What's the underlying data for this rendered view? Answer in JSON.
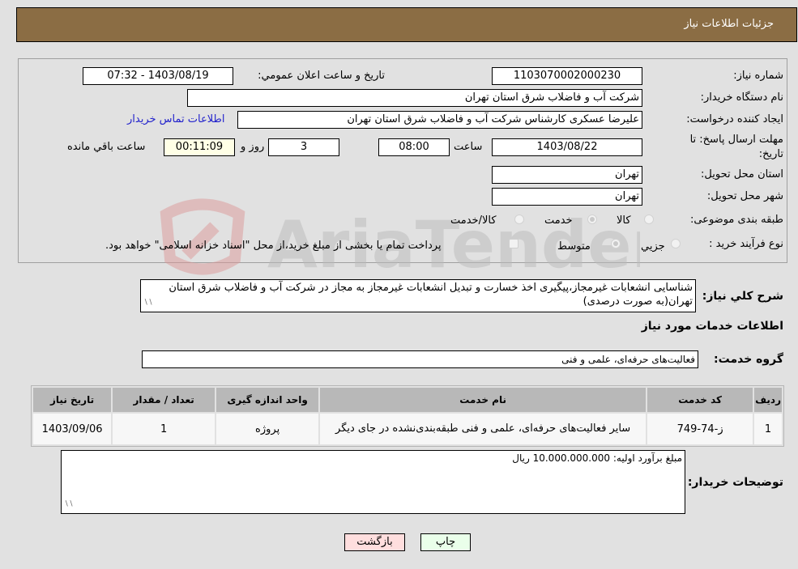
{
  "header": {
    "title": "جزئیات اطلاعات نیاز"
  },
  "details": {
    "need_number_label": "شماره نیاز:",
    "need_number": "1103070002000230",
    "announce_label": "تاریخ و ساعت اعلان عمومي:",
    "announce_value": "1403/08/19 - 07:32",
    "buyer_org_label": "نام دستگاه خریدار:",
    "buyer_org": "شرکت آب و فاضلاب شرق استان تهران",
    "creator_label": "ایجاد کننده درخواست:",
    "creator": "علیرضا عسکری کارشناس شرکت آب و فاضلاب شرق استان تهران",
    "contact_link": "اطلاعات تماس خریدار",
    "deadline_label": "مهلت ارسال پاسخ: تا تاریخ:",
    "deadline_date": "1403/08/22",
    "time_label": "ساعت",
    "deadline_time": "08:00",
    "days_value": "3",
    "days_label": "روز و",
    "remaining_value": "00:11:09",
    "remaining_label": "ساعت باقي مانده",
    "province_label": "استان محل تحویل:",
    "province": "تهران",
    "city_label": "شهر محل تحویل:",
    "city": "تهران",
    "category_label": "طبقه بندی موضوعی:",
    "category_options": [
      "کالا",
      "خدمت",
      "کالا/خدمت"
    ],
    "category_selected": "خدمت",
    "process_label": "نوع فرآیند خرید :",
    "process_options": [
      "جزيي",
      "متوسط"
    ],
    "process_selected": "متوسط",
    "treasury_note": "پرداخت تمام یا بخشی از مبلغ خرید،از محل \"اسناد خزانه اسلامی\" خواهد بود.",
    "treasury_checked": false
  },
  "description": {
    "label": "شرح کلي نياز:",
    "text": "شناسایی انشعابات غیرمجاز،پیگیری اخذ خسارت و تبدیل انشعابات غیرمجاز به مجاز در شرکت آب و فاضلاب شرق استان تهران(به صورت درصدی)"
  },
  "services": {
    "section_title": "اطلاعات خدمات مورد نیاز",
    "group_label": "گروه خدمت:",
    "group_value": "فعالیت‌های حرفه‌ای، علمی و فنی",
    "table": {
      "headers": [
        "ردیف",
        "کد خدمت",
        "نام خدمت",
        "واحد اندازه گیری",
        "تعداد / مقدار",
        "تاریخ نیاز"
      ],
      "rows": [
        [
          "1",
          "ز-74-749",
          "سایر فعالیت‌های حرفه‌ای، علمی و فنی طبقه‌بندی‌نشده در جای دیگر",
          "پروژه",
          "1",
          "1403/09/06"
        ]
      ]
    }
  },
  "buyer_notes": {
    "label": "توضیحات خریدار:",
    "text": "مبلغ برآورد اولیه: 10.000.000.000 ریال"
  },
  "buttons": {
    "print": "چاپ",
    "back": "بازگشت"
  },
  "colors": {
    "header_bg": "#8b6d44",
    "print_bg": "#eaffea",
    "back_bg": "#ffdede",
    "link": "#2222cc"
  },
  "watermark": "AriaTender.neT"
}
